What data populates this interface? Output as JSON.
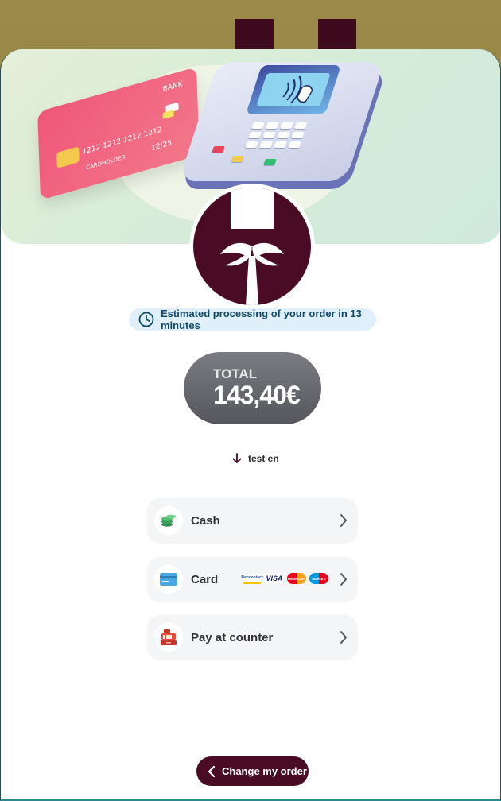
{
  "processing": {
    "estimate_text": "Estimated processing of your order in 13 minutes"
  },
  "order_total": {
    "label": "TOTAL",
    "amount": "143,40€"
  },
  "location": {
    "name": "test en"
  },
  "card_illustration": {
    "bank_text": "BANK",
    "number_text": "1212  1212  1212  1212",
    "holder_text": "CARDHOLDER",
    "expiry_text": "12/25"
  },
  "payment_methods": [
    {
      "label": "Cash",
      "icon": "cash-coins-icon",
      "icon_color": "#3aa35a"
    },
    {
      "label": "Card",
      "icon": "credit-card-icon",
      "icon_color": "#3aa0d8",
      "brands": [
        "Bancontact",
        "VISA",
        "MasterCard",
        "Maestro"
      ]
    },
    {
      "label": "Pay at counter",
      "icon": "cash-register-icon",
      "icon_color": "#e74c3c"
    }
  ],
  "footer": {
    "change_order_label": "Change my order"
  },
  "colors": {
    "brand_primary": "#4a0c24",
    "info_bg": "#dff0fb",
    "info_text": "#0e4a6a",
    "total_bg": "#66686e"
  }
}
